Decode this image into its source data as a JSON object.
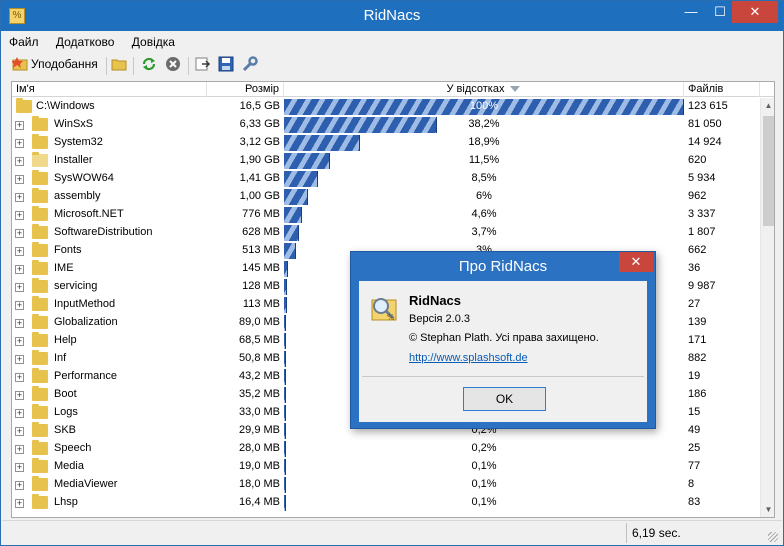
{
  "window": {
    "title": "RidNacs",
    "minimize": "—",
    "maximize": "☐",
    "close": "✕",
    "app_icon": "%"
  },
  "menu": [
    "Файл",
    "Додатково",
    "Довідка"
  ],
  "toolbar": {
    "favorites_label": "Уподобання"
  },
  "columns": {
    "name": "Ім'я",
    "size": "Розмір",
    "pct": "У відсотках",
    "files": "Файлів"
  },
  "rows": [
    {
      "name": "C:\\Windows",
      "size": "16,5 GB",
      "pct": "100%",
      "pct_value": 100,
      "files": "123 615"
    },
    {
      "name": "WinSxS",
      "size": "6,33 GB",
      "pct": "38,2%",
      "pct_value": 38.2,
      "files": "81 050"
    },
    {
      "name": "System32",
      "size": "3,12 GB",
      "pct": "18,9%",
      "pct_value": 18.9,
      "files": "14 924"
    },
    {
      "name": "Installer",
      "size": "1,90 GB",
      "pct": "11,5%",
      "pct_value": 11.5,
      "files": "620"
    },
    {
      "name": "SysWOW64",
      "size": "1,41 GB",
      "pct": "8,5%",
      "pct_value": 8.5,
      "files": "5 934"
    },
    {
      "name": "assembly",
      "size": "1,00 GB",
      "pct": "6%",
      "pct_value": 6,
      "files": "962"
    },
    {
      "name": "Microsoft.NET",
      "size": "776 MB",
      "pct": "4,6%",
      "pct_value": 4.6,
      "files": "3 337"
    },
    {
      "name": "SoftwareDistribution",
      "size": "628 MB",
      "pct": "3,7%",
      "pct_value": 3.7,
      "files": "1 807"
    },
    {
      "name": "Fonts",
      "size": "513 MB",
      "pct": "3%",
      "pct_value": 3,
      "files": "662"
    },
    {
      "name": "IME",
      "size": "145 MB",
      "pct": "",
      "pct_value": 0.9,
      "files": "36"
    },
    {
      "name": "servicing",
      "size": "128 MB",
      "pct": "",
      "pct_value": 0.8,
      "files": "9 987"
    },
    {
      "name": "InputMethod",
      "size": "113 MB",
      "pct": "",
      "pct_value": 0.7,
      "files": "27"
    },
    {
      "name": "Globalization",
      "size": "89,0 MB",
      "pct": "",
      "pct_value": 0.5,
      "files": "139"
    },
    {
      "name": "Help",
      "size": "68,5 MB",
      "pct": "",
      "pct_value": 0.4,
      "files": "171"
    },
    {
      "name": "Inf",
      "size": "50,8 MB",
      "pct": "",
      "pct_value": 0.3,
      "files": "882"
    },
    {
      "name": "Performance",
      "size": "43,2 MB",
      "pct": "",
      "pct_value": 0.3,
      "files": "19"
    },
    {
      "name": "Boot",
      "size": "35,2 MB",
      "pct": "",
      "pct_value": 0.2,
      "files": "186"
    },
    {
      "name": "Logs",
      "size": "33,0 MB",
      "pct": "",
      "pct_value": 0.2,
      "files": "15"
    },
    {
      "name": "SKB",
      "size": "29,9 MB",
      "pct": "0,2%",
      "pct_value": 0.2,
      "files": "49"
    },
    {
      "name": "Speech",
      "size": "28,0 MB",
      "pct": "0,2%",
      "pct_value": 0.2,
      "files": "25"
    },
    {
      "name": "Media",
      "size": "19,0 MB",
      "pct": "0,1%",
      "pct_value": 0.1,
      "files": "77"
    },
    {
      "name": "MediaViewer",
      "size": "18,0 MB",
      "pct": "0,1%",
      "pct_value": 0.1,
      "files": "8"
    },
    {
      "name": "Lhsp",
      "size": "16,4 MB",
      "pct": "0,1%",
      "pct_value": 0.1,
      "files": "83"
    }
  ],
  "status": {
    "time": "6,19 sec."
  },
  "dialog": {
    "title": "Про RidNacs",
    "close": "✕",
    "app_name": "RidNacs",
    "version": "Версія 2.0.3",
    "copyright": "© Stephan Plath. Усі права захищено.",
    "link": "http://www.splashsoft.de",
    "ok": "OK"
  },
  "colors": {
    "titlebar": "#1f6fbf",
    "close": "#c9463d",
    "bar": "#2d5fae"
  }
}
